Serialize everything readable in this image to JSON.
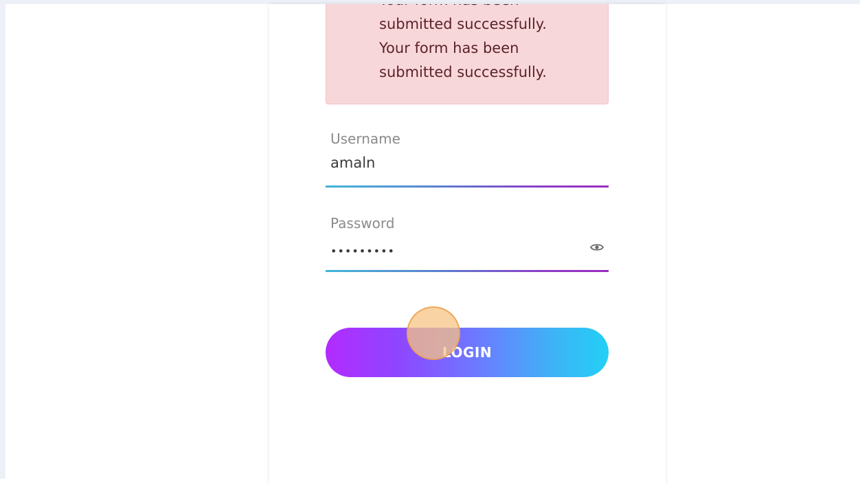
{
  "alert": {
    "lines": [
      "Your form has been",
      "submitted successfully.",
      "Your form has been",
      "submitted successfully."
    ],
    "background": "#f8d7da"
  },
  "form": {
    "username": {
      "label": "Username",
      "value": "amaln"
    },
    "password": {
      "label": "Password",
      "masked_value": "•••••••••",
      "toggle_icon": "eye-icon"
    },
    "login_label": "LOGIN"
  },
  "colors": {
    "button_gradient_start": "#b32bff",
    "button_gradient_end": "#22d0f6",
    "underline_start": "#41b6d8",
    "underline_end": "#9b2bbf"
  }
}
